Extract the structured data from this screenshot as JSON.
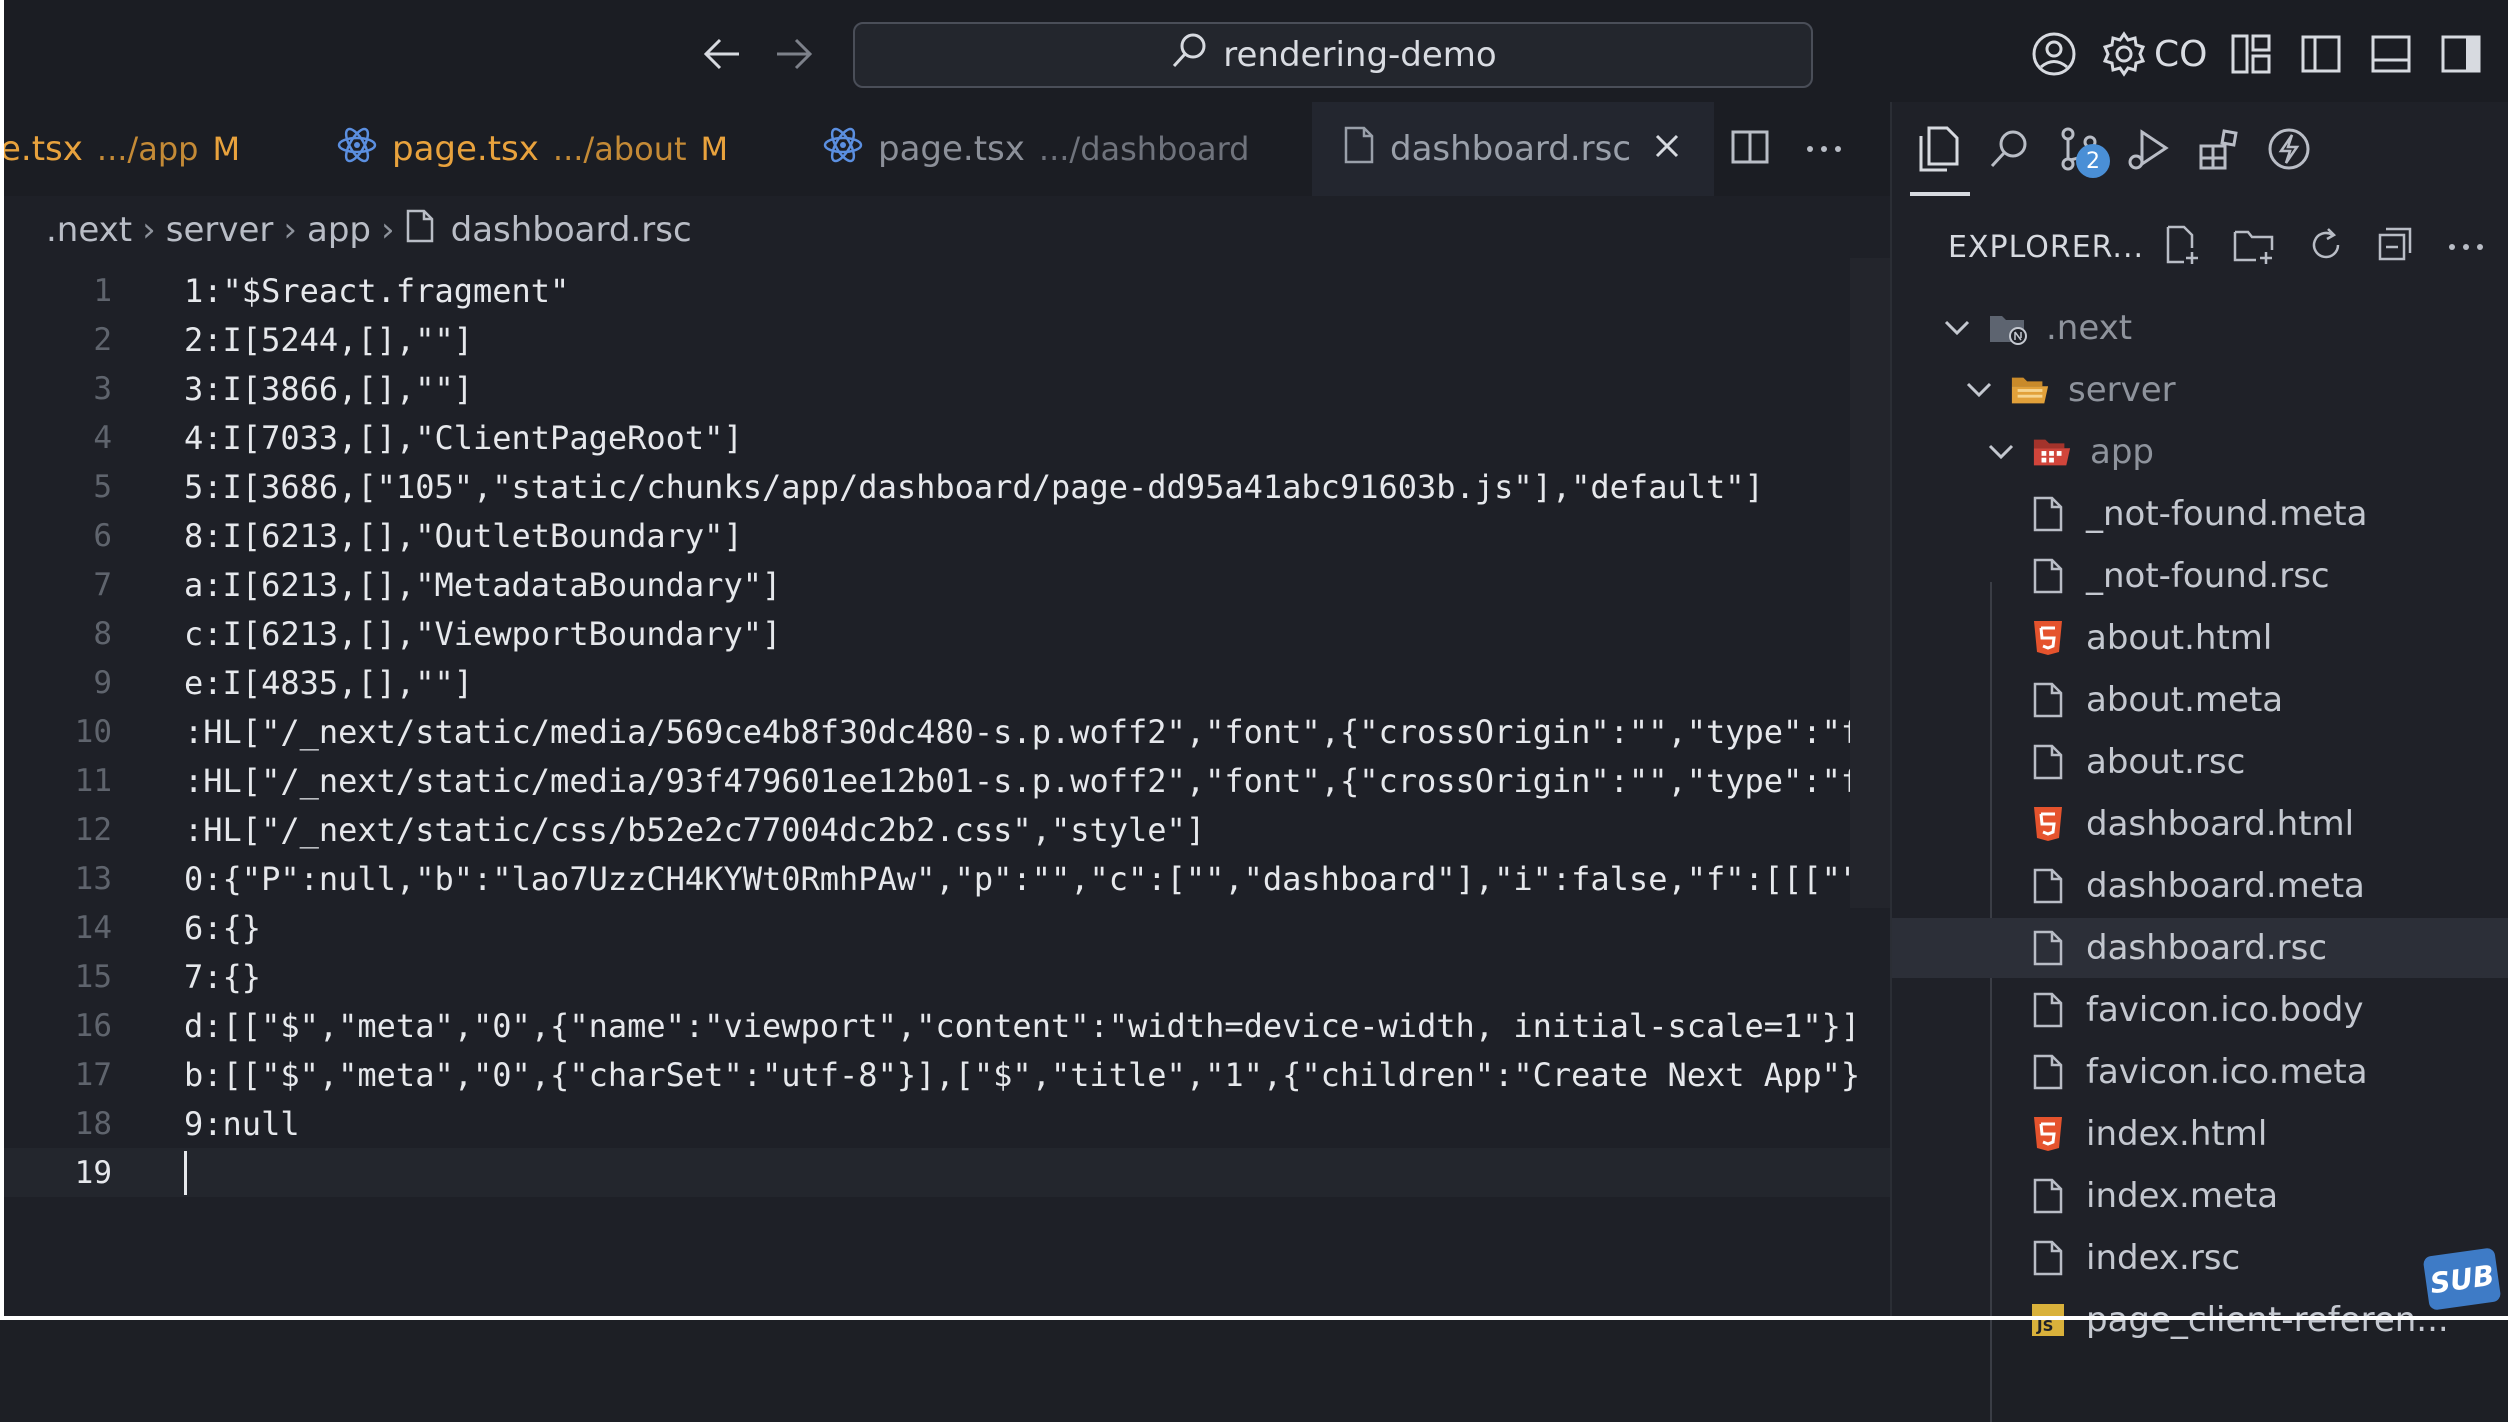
{
  "titlebar": {
    "search_text": "rendering-demo",
    "account_label": "CO"
  },
  "tabs": [
    {
      "name": "e.tsx",
      "path": ".../app",
      "modified": "M",
      "icon": "react-icon",
      "color": "#e8a23d"
    },
    {
      "name": "page.tsx",
      "path": ".../about",
      "modified": "M",
      "icon": "react-icon",
      "color": "#e8a23d"
    },
    {
      "name": "page.tsx",
      "path": ".../dashboard",
      "modified": "",
      "icon": "react-icon",
      "color": "#8c9099"
    },
    {
      "name": "dashboard.rsc",
      "path": "",
      "modified": "",
      "icon": "file-icon",
      "color": "#9aa0aa"
    }
  ],
  "breadcrumb": [
    ".next",
    "server",
    "app",
    "dashboard.rsc"
  ],
  "editor": {
    "lines": [
      {
        "n": "1",
        "text": "1:\"$Sreact.fragment\""
      },
      {
        "n": "2",
        "text": "2:I[5244,[],\"\"]"
      },
      {
        "n": "3",
        "text": "3:I[3866,[],\"\"]"
      },
      {
        "n": "4",
        "text": "4:I[7033,[],\"ClientPageRoot\"]"
      },
      {
        "n": "5",
        "text": "5:I[3686,[\"105\",\"static/chunks/app/dashboard/page-dd95a41abc91603b.js\"],\"default\"]"
      },
      {
        "n": "6",
        "text": "8:I[6213,[],\"OutletBoundary\"]"
      },
      {
        "n": "7",
        "text": "a:I[6213,[],\"MetadataBoundary\"]"
      },
      {
        "n": "8",
        "text": "c:I[6213,[],\"ViewportBoundary\"]"
      },
      {
        "n": "9",
        "text": "e:I[4835,[],\"\"]"
      },
      {
        "n": "10",
        "text": ":HL[\"/_next/static/media/569ce4b8f30dc480-s.p.woff2\",\"font\",{\"crossOrigin\":\"\",\"type\":\"f"
      },
      {
        "n": "11",
        "text": ":HL[\"/_next/static/media/93f479601ee12b01-s.p.woff2\",\"font\",{\"crossOrigin\":\"\",\"type\":\"f"
      },
      {
        "n": "12",
        "text": ":HL[\"/_next/static/css/b52e2c77004dc2b2.css\",\"style\"]"
      },
      {
        "n": "13",
        "text": "0:{\"P\":null,\"b\":\"lao7UzzCH4KYWt0RmhPAw\",\"p\":\"\",\"c\":[\"\",\"dashboard\"],\"i\":false,\"f\":[[[\"\""
      },
      {
        "n": "14",
        "text": "6:{}"
      },
      {
        "n": "15",
        "text": "7:{}"
      },
      {
        "n": "16",
        "text": "d:[[\"$\",\"meta\",\"0\",{\"name\":\"viewport\",\"content\":\"width=device-width, initial-scale=1\"}]"
      },
      {
        "n": "17",
        "text": "b:[[\"$\",\"meta\",\"0\",{\"charSet\":\"utf-8\"}],[\"$\",\"title\",\"1\",{\"children\":\"Create Next App\"}"
      },
      {
        "n": "18",
        "text": "9:null"
      },
      {
        "n": "19",
        "text": ""
      }
    ]
  },
  "explorer": {
    "title": "EXPLORER...",
    "scm_badge": "2",
    "tree": [
      {
        "label": ".next",
        "icon": "next-folder-icon",
        "chev": true
      },
      {
        "label": "server",
        "icon": "folder-open-icon",
        "chev": true
      },
      {
        "label": "app",
        "icon": "app-folder-icon",
        "chev": true
      },
      {
        "label": "_not-found.meta",
        "icon": "file-icon"
      },
      {
        "label": "_not-found.rsc",
        "icon": "file-icon"
      },
      {
        "label": "about.html",
        "icon": "html-icon"
      },
      {
        "label": "about.meta",
        "icon": "file-icon"
      },
      {
        "label": "about.rsc",
        "icon": "file-icon"
      },
      {
        "label": "dashboard.html",
        "icon": "html-icon"
      },
      {
        "label": "dashboard.meta",
        "icon": "file-icon"
      },
      {
        "label": "dashboard.rsc",
        "icon": "file-icon",
        "selected": true
      },
      {
        "label": "favicon.ico.body",
        "icon": "file-icon"
      },
      {
        "label": "favicon.ico.meta",
        "icon": "file-icon"
      },
      {
        "label": "index.html",
        "icon": "html-icon"
      },
      {
        "label": "index.meta",
        "icon": "file-icon"
      },
      {
        "label": "index.rsc",
        "icon": "file-icon"
      },
      {
        "label": "page_client-referen...",
        "icon": "js-icon"
      }
    ]
  },
  "watermark": "SUB",
  "colors": {
    "modified": "#e8a23d",
    "react": "#5b8fe0",
    "html": "#e5532d",
    "js": "#d9b13b",
    "folder_app": "#d1453b",
    "folder_server": "#e2a13a"
  }
}
